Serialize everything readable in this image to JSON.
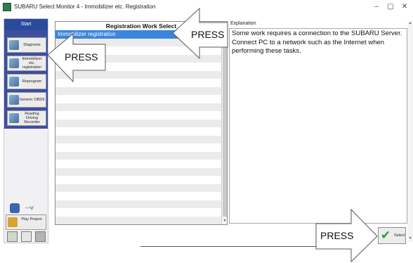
{
  "window": {
    "title": "SUBARU Select Monitor 4 - Immobilizer etc. Registration",
    "minimize": "–",
    "maximize": "▢",
    "close": "✕"
  },
  "sidebar": {
    "start_label": "Start",
    "items": [
      {
        "label": "Diagnosis",
        "icon": "diagnosis-icon"
      },
      {
        "label": "Immobilizer etc. registration",
        "icon": "immobilizer-icon"
      },
      {
        "label": "Reprogram",
        "icon": "reprogram-icon"
      },
      {
        "label": "Generic OBDII",
        "icon": "obd-icon"
      },
      {
        "label": "Reading Driving Recorder",
        "icon": "recorder-icon"
      }
    ],
    "status_text": "---V",
    "play_label": "Play Project"
  },
  "work_list": {
    "header": "Registration Work Select",
    "rows": [
      {
        "label": "Immobilizer registration",
        "selected": true
      }
    ],
    "empty_rows": 23
  },
  "explanation": {
    "label": "Explanation",
    "text": "Some work requires a connection to the SUBARU Server. Connect PC to a network such as the Internet when performing these tasks."
  },
  "select_button": {
    "label": "Select"
  },
  "callouts": [
    {
      "text": "PRESS"
    },
    {
      "text": "PRESS"
    },
    {
      "text": "PRESS"
    }
  ],
  "colors": {
    "nav_frame": "#3d4fa0",
    "selected_row": "#3a86d8",
    "check": "#2e9a2e",
    "callout_fill": "#ffffff"
  }
}
